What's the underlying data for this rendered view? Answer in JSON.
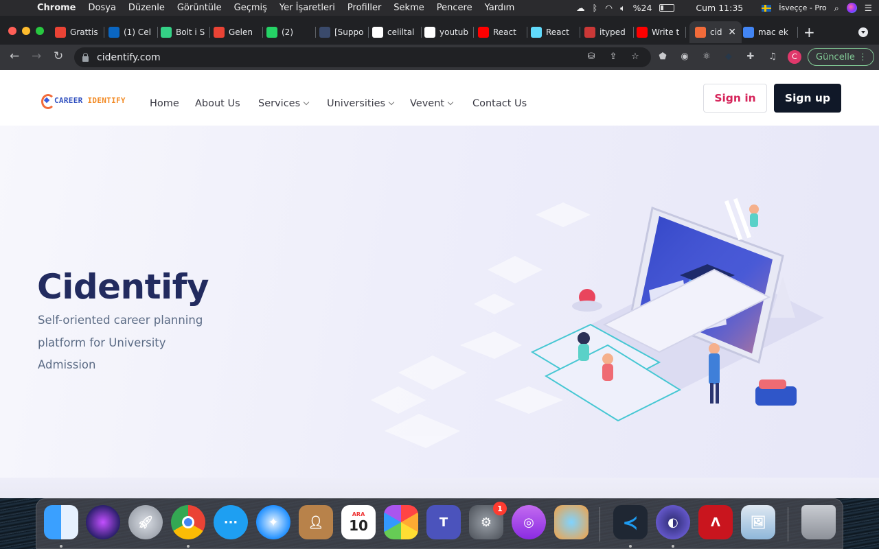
{
  "menubar": {
    "app_name": "Chrome",
    "items": [
      "Dosya",
      "Düzenle",
      "Görüntüle",
      "Geçmiş",
      "Yer İşaretleri",
      "Profiller",
      "Sekme",
      "Pencere",
      "Yardım"
    ],
    "battery": "%24",
    "datetime": "Cum 11:35",
    "input_source": "İsveççe - Pro"
  },
  "tabs": [
    {
      "label": "Grattis",
      "icon": "gmail-icon",
      "color": "#ea4335"
    },
    {
      "label": "(1) Cel",
      "icon": "linkedin-icon",
      "color": "#0a66c2"
    },
    {
      "label": "Bolt i S",
      "icon": "bolt-icon",
      "color": "#34d186"
    },
    {
      "label": "Gelen",
      "icon": "gmail-icon",
      "color": "#ea4335"
    },
    {
      "label": "(2)",
      "icon": "whatsapp-icon",
      "color": "#25d366"
    },
    {
      "label": "[Suppo",
      "icon": "support-icon",
      "color": "#3a4a6b"
    },
    {
      "label": "celiltal",
      "icon": "github-icon",
      "color": "#ffffff"
    },
    {
      "label": "youtub",
      "icon": "github-icon",
      "color": "#ffffff"
    },
    {
      "label": "React",
      "icon": "youtube-icon",
      "color": "#ff0000"
    },
    {
      "label": "React",
      "icon": "react-icon",
      "color": "#61dafb"
    },
    {
      "label": "ityped",
      "icon": "npm-icon",
      "color": "#cb3837"
    },
    {
      "label": "Write t",
      "icon": "youtube-icon",
      "color": "#ff0000"
    },
    {
      "label": "cid",
      "icon": "cidentify-icon",
      "color": "#f26b3a",
      "active": true
    },
    {
      "label": "mac ek",
      "icon": "google-icon",
      "color": "#4285f4"
    }
  ],
  "omnibox": {
    "url": "cidentify.com"
  },
  "toolbar": {
    "update_label": "Güncelle",
    "profile_initial": "C"
  },
  "site": {
    "logo": {
      "part1": "CAREER ",
      "part2": "IDENTIFY"
    },
    "nav": [
      {
        "label": "Home",
        "dropdown": false
      },
      {
        "label": "About Us",
        "dropdown": false
      },
      {
        "label": "Services",
        "dropdown": true
      },
      {
        "label": "Universities",
        "dropdown": true
      },
      {
        "label": "Vevent",
        "dropdown": true
      },
      {
        "label": "Contact Us",
        "dropdown": false
      }
    ],
    "signin_label": "Sign in",
    "signup_label": "Sign up",
    "hero": {
      "title": "Cidentify",
      "subtitle": "Self-oriented career planning platform for University Admission"
    }
  },
  "dock": {
    "calendar_month": "ARA",
    "calendar_day": "10",
    "settings_badge": "1",
    "apps": [
      "finder",
      "siri",
      "launchpad",
      "chrome",
      "messenger",
      "safari",
      "contacts",
      "calendar",
      "photos",
      "teams",
      "system-preferences",
      "podcasts",
      "preview-bird",
      "vscode",
      "cloud-app",
      "acrobat",
      "preview",
      "trash"
    ]
  },
  "colors": {
    "accent_signin": "#d6245a",
    "signup_bg": "#101828",
    "hero_title": "#222b5f",
    "update_green": "#81c995"
  }
}
